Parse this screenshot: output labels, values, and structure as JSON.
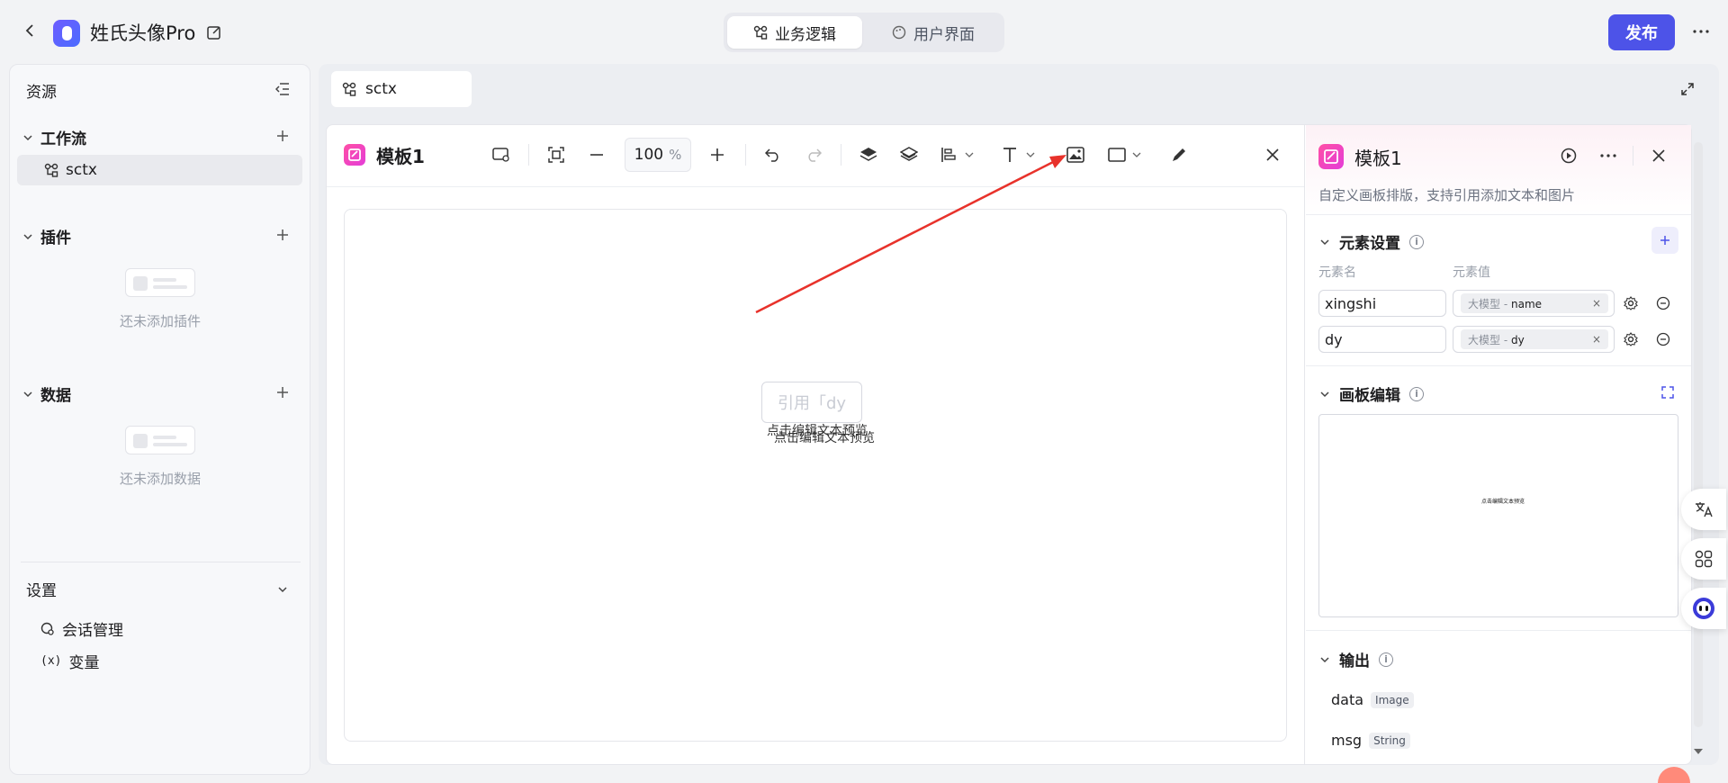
{
  "header": {
    "app_title": "姓氏头像Pro",
    "mode_tabs": [
      {
        "label": "业务逻辑",
        "active": true
      },
      {
        "label": "用户界面",
        "active": false
      }
    ],
    "publish_label": "发布"
  },
  "sidebar": {
    "title": "资源",
    "sections": [
      {
        "label": "工作流",
        "items": [
          "sctx"
        ],
        "empty_text": ""
      },
      {
        "label": "插件",
        "items": [],
        "empty_text": "还未添加插件"
      },
      {
        "label": "数据",
        "items": [],
        "empty_text": "还未添加数据"
      }
    ],
    "settings": {
      "title": "设置",
      "items": [
        {
          "label": "会话管理",
          "icon": "chat-settings-icon"
        },
        {
          "label": "变量",
          "icon": "variable-icon"
        }
      ]
    }
  },
  "workspace": {
    "tab_label": "sctx"
  },
  "editor": {
    "title": "模板1",
    "zoom_value": "100",
    "zoom_unit": "%",
    "canvas_text_1": "点击编辑文本预览",
    "canvas_text_2": "点击编辑文本预览",
    "canvas_ref_ghost": "引用「dy"
  },
  "properties": {
    "title": "模板1",
    "description": "自定义画板排版，支持引用添加文本和图片",
    "element_settings": {
      "title": "元素设置",
      "col_name": "元素名",
      "col_value": "元素值",
      "rows": [
        {
          "name": "xingshi",
          "source": "大模型",
          "field": "name"
        },
        {
          "name": "dy",
          "source": "大模型",
          "field": "dy"
        }
      ]
    },
    "board_edit": {
      "title": "画板编辑"
    },
    "output": {
      "title": "输出",
      "items": [
        {
          "name": "data",
          "type": "Image"
        },
        {
          "name": "msg",
          "type": "String"
        }
      ]
    }
  },
  "colors": {
    "accent": "#4d53e8",
    "annotation_arrow": "#e8322b"
  }
}
